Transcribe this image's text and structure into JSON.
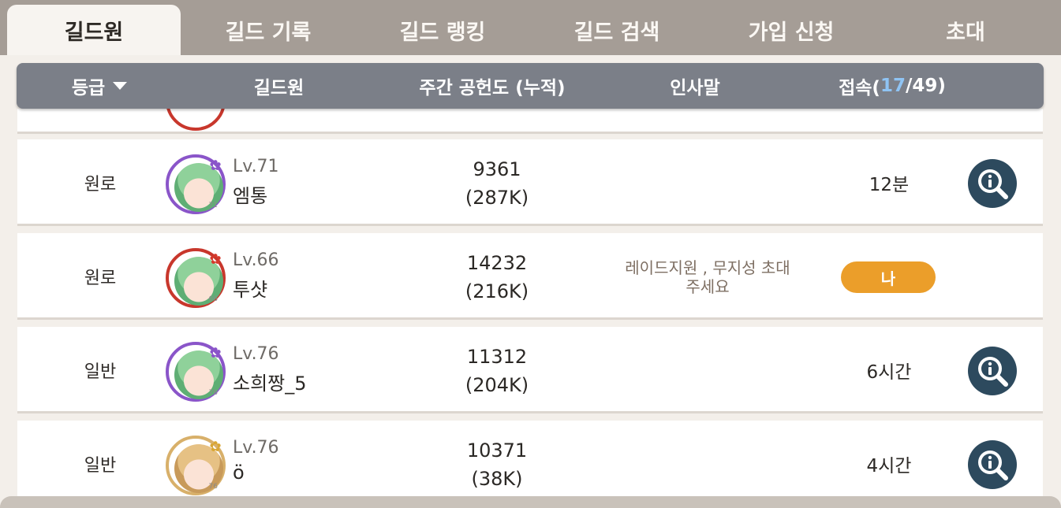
{
  "tabs": [
    {
      "label": "길드원",
      "active": true
    },
    {
      "label": "길드 기록",
      "active": false
    },
    {
      "label": "길드 랭킹",
      "active": false
    },
    {
      "label": "길드 검색",
      "active": false
    },
    {
      "label": "가입 신청",
      "active": false
    },
    {
      "label": "초대",
      "active": false
    }
  ],
  "header": {
    "grade": "등급",
    "member": "길드원",
    "weekly": "주간 공헌도 (누적)",
    "greeting": "인사말",
    "access_prefix": "접속(",
    "access_online": "17",
    "access_total": "/49)"
  },
  "members": [
    {
      "grade": "원로",
      "level": "Lv.71",
      "name": "엠통",
      "weekly": "9361",
      "total": "(287K)",
      "greeting1": "",
      "greeting2": "",
      "access": "12분",
      "is_me": false,
      "frame_color": "#8a55c9",
      "badge_icon": "purple-flower-icon",
      "mini_level": "71"
    },
    {
      "grade": "원로",
      "level": "Lv.66",
      "name": "투샷",
      "weekly": "14232",
      "total": "(216K)",
      "greeting1": "레이드지원 , 무지성 초대",
      "greeting2": "주세요",
      "access": "나",
      "is_me": true,
      "frame_color": "#c8372c",
      "badge_icon": "red-flower-icon",
      "mini_level": "66"
    },
    {
      "grade": "일반",
      "level": "Lv.76",
      "name": "소희짱_5",
      "weekly": "11312",
      "total": "(204K)",
      "greeting1": "",
      "greeting2": "",
      "access": "6시간",
      "is_me": false,
      "frame_color": "#8a55c9",
      "badge_icon": "purple-flower-icon",
      "mini_level": "76"
    },
    {
      "grade": "일반",
      "level": "Lv.76",
      "name": "ö",
      "weekly": "10371",
      "total": "(38K)",
      "greeting1": "",
      "greeting2": "",
      "access": "4시간",
      "is_me": false,
      "frame_color": "#d8b06a",
      "badge_icon": "gold-flower-icon",
      "mini_level": "76"
    }
  ],
  "colors": {
    "tab_bg": "#a59d96",
    "header_bg": "#7b7f88",
    "highlight": "#8fc4f4",
    "me_button": "#eb9e2a",
    "inspect_button": "#2d4a5e"
  }
}
